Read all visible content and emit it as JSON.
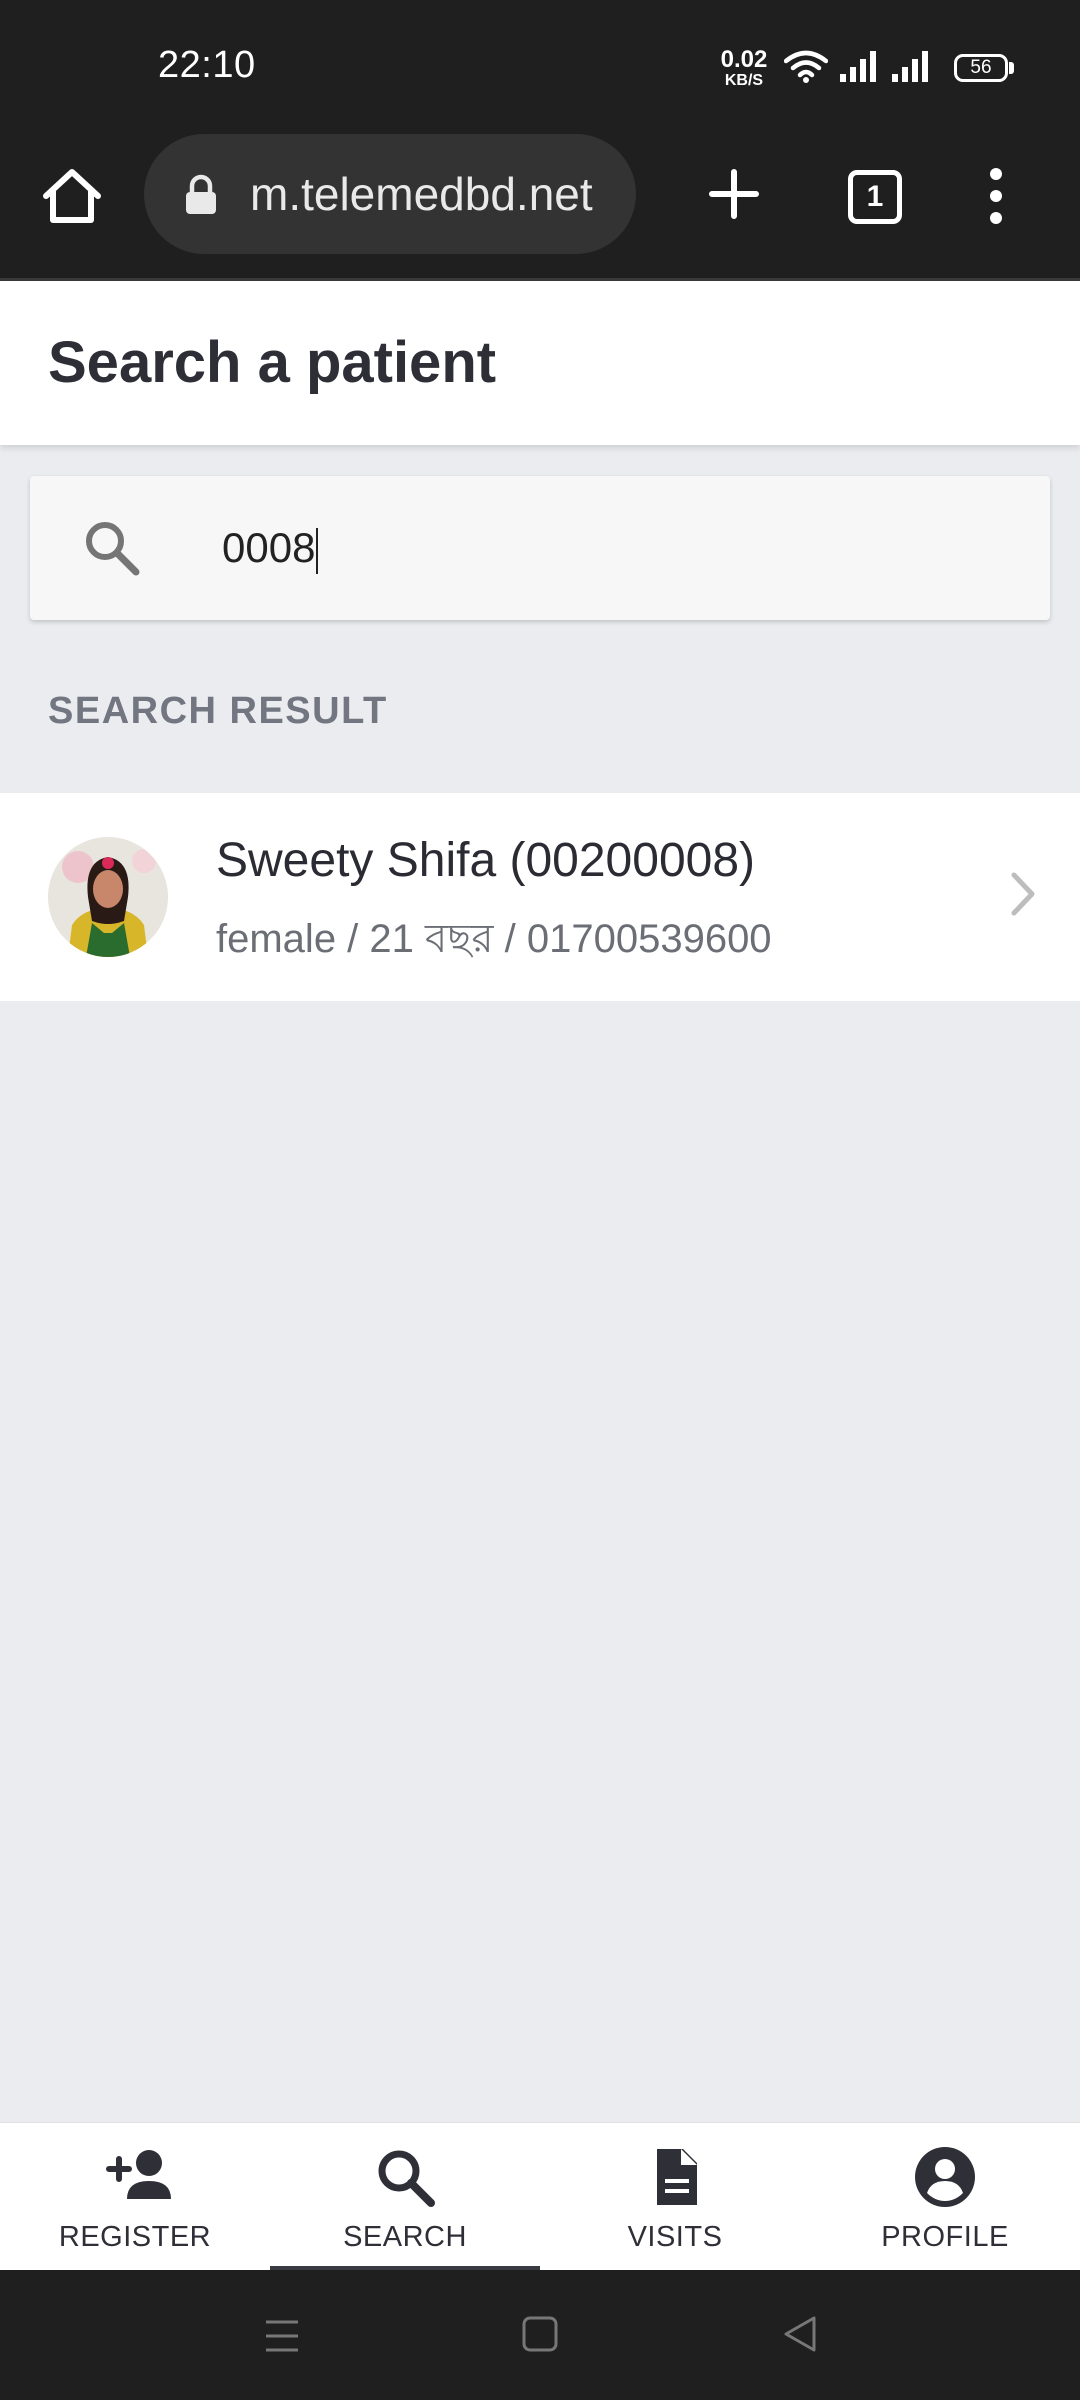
{
  "status_bar": {
    "time": "22:10",
    "net_speed_value": "0.02",
    "net_speed_unit": "KB/S",
    "battery": "56"
  },
  "browser": {
    "url": "m.telemedbd.net",
    "tab_count": "1"
  },
  "page": {
    "title": "Search a patient"
  },
  "search": {
    "value": "0008"
  },
  "results": {
    "section_label": "SEARCH RESULT",
    "items": [
      {
        "name": "Sweety Shifa (00200008)",
        "meta": "female / 21 বছর / 01700539600"
      }
    ]
  },
  "bottom_nav": {
    "items": [
      {
        "label": "REGISTER",
        "icon": "person-add-icon"
      },
      {
        "label": "SEARCH",
        "icon": "search-icon",
        "active": true
      },
      {
        "label": "VISITS",
        "icon": "document-icon"
      },
      {
        "label": "PROFILE",
        "icon": "account-circle-icon"
      }
    ]
  }
}
